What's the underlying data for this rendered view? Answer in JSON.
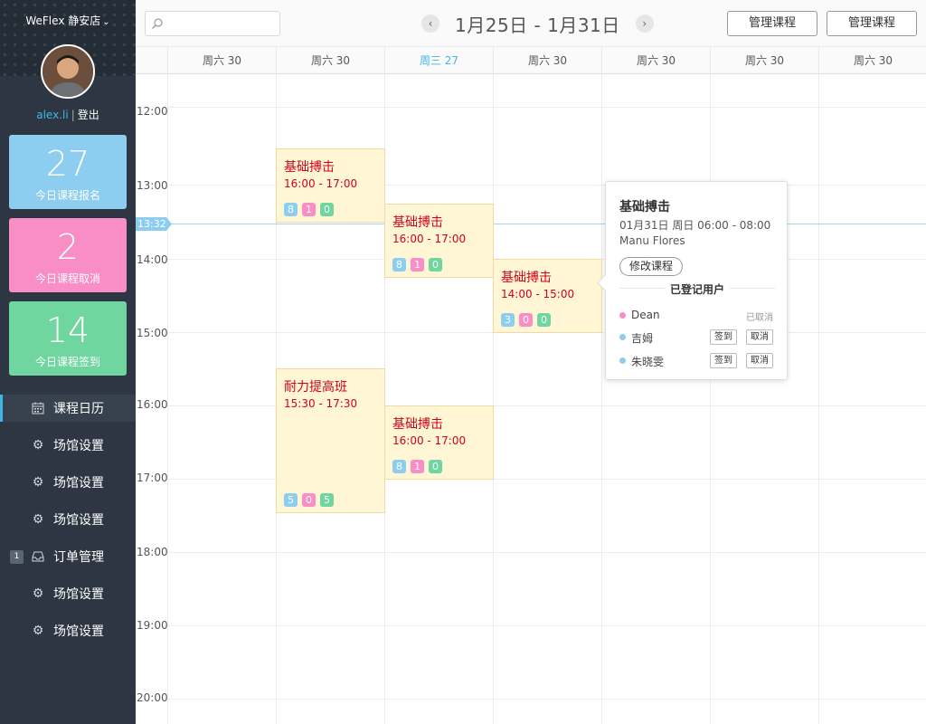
{
  "sidebar": {
    "store_name": "WeFlex 静安店",
    "username": "alex.li",
    "logout_label": "登出",
    "stats": [
      {
        "value": "27",
        "label": "今日课程报名",
        "color": "#8ccdf0"
      },
      {
        "value": "2",
        "label": "今日课程取消",
        "color": "#f98ec6"
      },
      {
        "value": "14",
        "label": "今日课程签到",
        "color": "#6fd6a0"
      }
    ],
    "nav": [
      {
        "label": "课程日历",
        "icon": "calendar-icon",
        "active": true
      },
      {
        "label": "场馆设置",
        "icon": "gear-icon"
      },
      {
        "label": "场馆设置",
        "icon": "gear-icon"
      },
      {
        "label": "场馆设置",
        "icon": "gear-icon"
      },
      {
        "label": "订单管理",
        "icon": "inbox-icon",
        "badge": "1"
      },
      {
        "label": "场馆设置",
        "icon": "gear-icon"
      },
      {
        "label": "场馆设置",
        "icon": "gear-icon"
      }
    ]
  },
  "header": {
    "search_placeholder": "",
    "week_title": "1月25日 - 1月31日",
    "buttons": [
      "管理课程",
      "管理课程"
    ]
  },
  "days": [
    {
      "label": "周六 30"
    },
    {
      "label": "周六 30"
    },
    {
      "label": "周三 27",
      "today": true
    },
    {
      "label": "周六 30"
    },
    {
      "label": "周六 30"
    },
    {
      "label": "周六 30"
    },
    {
      "label": "周六 30"
    }
  ],
  "times": [
    "12:00",
    "13:00",
    "14:00",
    "15:00",
    "16:00",
    "17:00",
    "18:00",
    "19:00",
    "20:00"
  ],
  "now_time": "13:32",
  "events": [
    {
      "title": "基础搏击",
      "time": "16:00 - 17:00",
      "badges": [
        "8",
        "1",
        "0"
      ]
    },
    {
      "title": "基础搏击",
      "time": "16:00 - 17:00",
      "badges": [
        "8",
        "1",
        "0"
      ]
    },
    {
      "title": "基础搏击",
      "time": "14:00 - 15:00",
      "badges": [
        "3",
        "0",
        "0"
      ]
    },
    {
      "title": "耐力提高班",
      "time": "15:30 - 17:30",
      "badges": [
        "5",
        "0",
        "5"
      ]
    },
    {
      "title": "基础搏击",
      "time": "16:00 - 17:00",
      "badges": [
        "8",
        "1",
        "0"
      ]
    }
  ],
  "popover": {
    "title": "基础搏击",
    "when": "01月31日 周日 06:00 - 08:00",
    "coach": "Manu Flores",
    "edit_label": "修改课程",
    "section_label": "已登记用户",
    "users": [
      {
        "name": "Dean",
        "status": "已取消",
        "dot": "#f98ec6"
      },
      {
        "name": "吉姆",
        "checkin_label": "签到",
        "cancel_label": "取消",
        "dot": "#8ccdf0"
      },
      {
        "name": "朱晓雯",
        "checkin_label": "签到",
        "cancel_label": "取消",
        "dot": "#8ccdf0"
      }
    ]
  },
  "colors": {
    "sidebar_bg": "#2d3642",
    "accent": "#3fb6e8",
    "event_bg": "#fff6d5",
    "event_text": "#d0021b",
    "badge_blue": "#8ccdf0",
    "badge_pink": "#f98ec6",
    "badge_green": "#6fd6a0"
  }
}
